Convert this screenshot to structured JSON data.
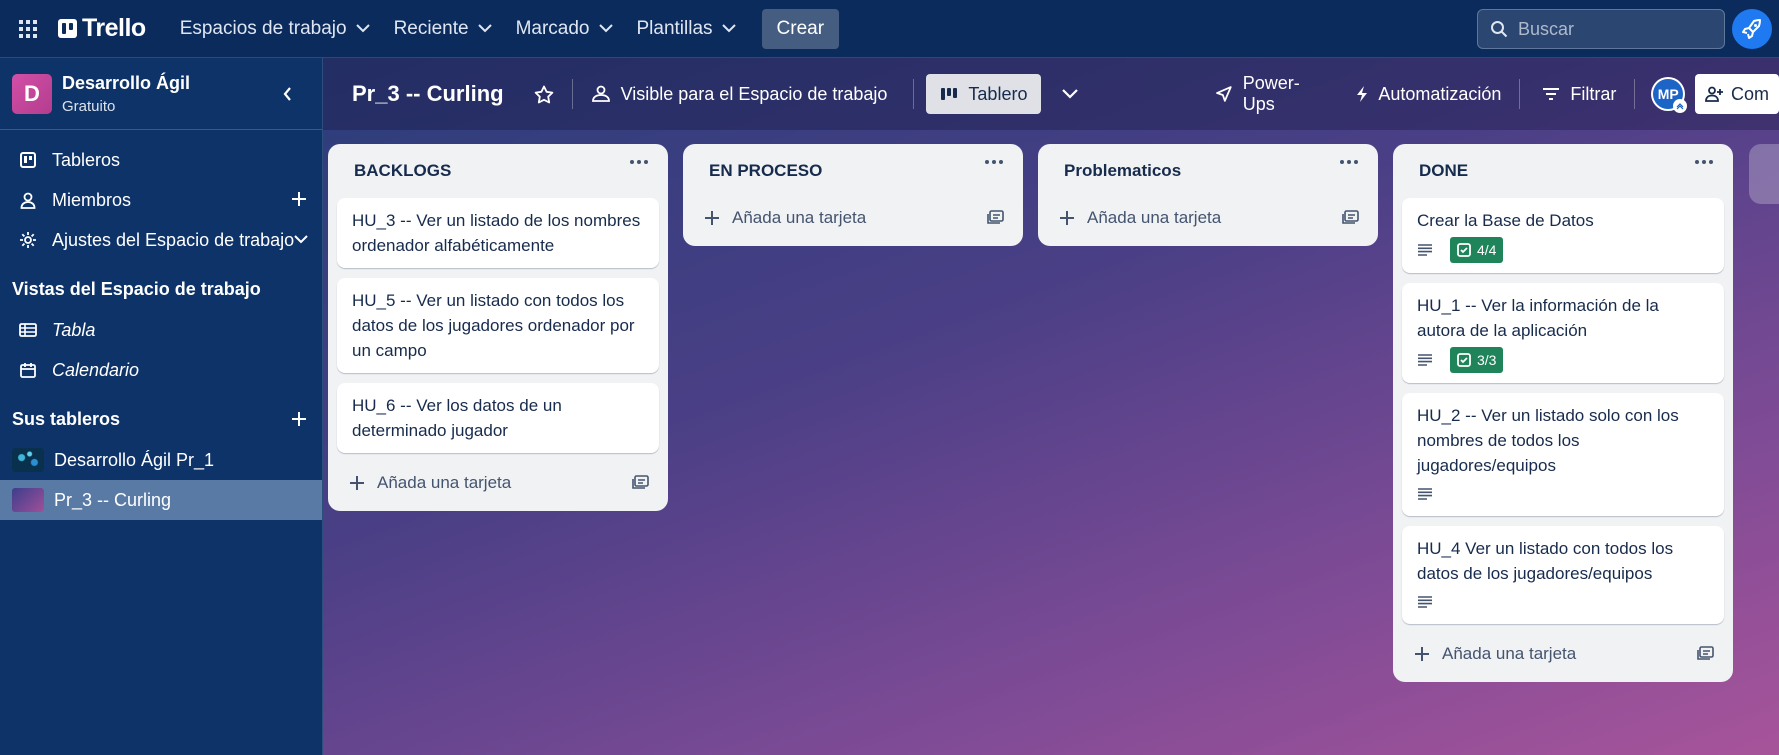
{
  "topbar": {
    "brand": "Trello",
    "nav": [
      {
        "label": "Espacios de trabajo"
      },
      {
        "label": "Reciente"
      },
      {
        "label": "Marcado"
      },
      {
        "label": "Plantillas"
      }
    ],
    "create_label": "Crear",
    "search_placeholder": "Buscar"
  },
  "sidebar": {
    "workspace_initial": "D",
    "workspace_name": "Desarrollo Ágil",
    "workspace_plan": "Gratuito",
    "items": [
      {
        "label": "Tableros"
      },
      {
        "label": "Miembros"
      },
      {
        "label": "Ajustes del Espacio de trabajo"
      }
    ],
    "views_title": "Vistas del Espacio de trabajo",
    "views": [
      {
        "label": "Tabla"
      },
      {
        "label": "Calendario"
      }
    ],
    "boards_title": "Sus tableros",
    "boards": [
      {
        "label": "Desarrollo Ágil Pr_1"
      },
      {
        "label": "Pr_3 -- Curling"
      }
    ]
  },
  "board": {
    "title": "Pr_3 -- Curling",
    "visibility": "Visible para el Espacio de trabajo",
    "view_label": "Tablero",
    "powerups": "Power-Ups",
    "automation": "Automatización",
    "filter": "Filtrar",
    "member_initials": "MP",
    "share_label": "Com"
  },
  "lists": [
    {
      "title": "BACKLOGS",
      "cards": [
        {
          "title": "HU_3 -- Ver un listado de los nombres ordenador alfabéticamente"
        },
        {
          "title": "HU_5 -- Ver un listado con todos los datos de los jugadores ordenador por un campo"
        },
        {
          "title": "HU_6 -- Ver los datos de un determinado jugador"
        }
      ],
      "add_label": "Añada una tarjeta"
    },
    {
      "title": "EN PROCESO",
      "cards": [],
      "add_label": "Añada una tarjeta"
    },
    {
      "title": "Problematicos",
      "cards": [],
      "add_label": "Añada una tarjeta"
    },
    {
      "title": "DONE",
      "cards": [
        {
          "title": "Crear la Base de Datos",
          "description": true,
          "checklist": "4/4"
        },
        {
          "title": "HU_1 -- Ver la información de la autora de la aplicación",
          "description": true,
          "checklist": "3/3"
        },
        {
          "title": "HU_2 -- Ver un listado solo con los nombres de todos los jugadores/equipos",
          "description": true
        },
        {
          "title": "HU_4 Ver un listado con todos los datos de los jugadores/equipos",
          "description": true
        }
      ],
      "add_label": "Añada una tarjeta"
    }
  ],
  "colors": {
    "topbar_bg": "#0b2b5c",
    "sidebar_bg": "#0e3369",
    "checklist_complete": "#1f845a",
    "list_bg": "#f1f2f4"
  }
}
